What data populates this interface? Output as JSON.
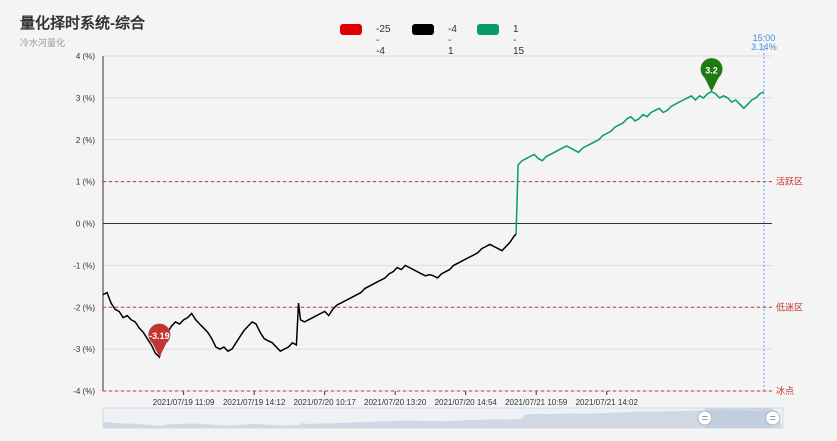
{
  "title": "量化择时系统-综合",
  "subtitle": "冷水河量化",
  "legend": [
    {
      "label": "-25 - -4",
      "color": "#e00000"
    },
    {
      "label": "-4 - 1",
      "color": "#000000"
    },
    {
      "label": "1 - 15",
      "color": "#079b6b"
    }
  ],
  "chart_data": {
    "type": "line",
    "title": "量化择时系统-综合",
    "ylabel": "",
    "ylim": [
      -4,
      4
    ],
    "y_ticks": [
      "-4 (%)",
      "-3 (%)",
      "-2 (%)",
      "-1 (%)",
      "0 (%)",
      "1 (%)",
      "2 (%)",
      "3 (%)",
      "4 (%)"
    ],
    "x_tick_labels": [
      "2021/07/19 11:09",
      "2021/07/19 14:12",
      "2021/07/20 10:17",
      "2021/07/20 13:20",
      "2021/07/20 14:54",
      "2021/07/21 10:59",
      "2021/07/21 14:02"
    ],
    "markers": [
      {
        "label": "-3.19",
        "value": -3.19,
        "color": "#c23531"
      },
      {
        "label": "3.2",
        "value": 3.2,
        "color": "#1e7a12"
      }
    ],
    "thresholds": [
      {
        "value": 1,
        "label": "活跃区"
      },
      {
        "value": -2,
        "label": "低迷区"
      },
      {
        "value": -4,
        "label": "冰点"
      }
    ],
    "crosshair": {
      "time": "15:00",
      "value": "3.14%"
    },
    "series": [
      {
        "points": [
          [
            0,
            -1.7
          ],
          [
            2,
            -1.65
          ],
          [
            4,
            -1.9
          ],
          [
            6,
            -2.05
          ],
          [
            8,
            -2.1
          ],
          [
            10,
            -2.25
          ],
          [
            12,
            -2.2
          ],
          [
            14,
            -2.3
          ],
          [
            16,
            -2.35
          ],
          [
            18,
            -2.5
          ],
          [
            20,
            -2.6
          ],
          [
            22,
            -2.75
          ],
          [
            24,
            -2.9
          ],
          [
            26,
            -3.1
          ],
          [
            28,
            -3.19
          ],
          [
            30,
            -2.75
          ],
          [
            32,
            -2.6
          ],
          [
            34,
            -2.45
          ],
          [
            36,
            -2.35
          ],
          [
            38,
            -2.4
          ],
          [
            40,
            -2.3
          ],
          [
            42,
            -2.25
          ],
          [
            44,
            -2.15
          ],
          [
            46,
            -2.3
          ],
          [
            48,
            -2.4
          ],
          [
            50,
            -2.5
          ],
          [
            52,
            -2.6
          ],
          [
            54,
            -2.75
          ],
          [
            56,
            -2.95
          ],
          [
            58,
            -3.0
          ],
          [
            60,
            -2.95
          ],
          [
            62,
            -3.05
          ],
          [
            64,
            -3.0
          ],
          [
            66,
            -2.85
          ],
          [
            68,
            -2.7
          ],
          [
            70,
            -2.55
          ],
          [
            72,
            -2.45
          ],
          [
            74,
            -2.35
          ],
          [
            76,
            -2.4
          ],
          [
            78,
            -2.6
          ],
          [
            80,
            -2.75
          ],
          [
            82,
            -2.8
          ],
          [
            84,
            -2.85
          ],
          [
            86,
            -2.95
          ],
          [
            88,
            -3.05
          ],
          [
            90,
            -3.0
          ],
          [
            92,
            -2.95
          ],
          [
            94,
            -2.85
          ],
          [
            96,
            -2.9
          ],
          [
            97,
            -1.9
          ],
          [
            98,
            -2.3
          ],
          [
            100,
            -2.35
          ],
          [
            102,
            -2.3
          ],
          [
            104,
            -2.25
          ],
          [
            106,
            -2.2
          ],
          [
            108,
            -2.15
          ],
          [
            110,
            -2.1
          ],
          [
            112,
            -2.2
          ],
          [
            114,
            -2.05
          ],
          [
            116,
            -1.95
          ],
          [
            118,
            -1.9
          ],
          [
            120,
            -1.85
          ],
          [
            122,
            -1.8
          ],
          [
            124,
            -1.75
          ],
          [
            126,
            -1.7
          ],
          [
            128,
            -1.65
          ],
          [
            130,
            -1.55
          ],
          [
            132,
            -1.5
          ],
          [
            134,
            -1.45
          ],
          [
            136,
            -1.4
          ],
          [
            138,
            -1.35
          ],
          [
            140,
            -1.3
          ],
          [
            142,
            -1.2
          ],
          [
            144,
            -1.15
          ],
          [
            146,
            -1.05
          ],
          [
            148,
            -1.1
          ],
          [
            150,
            -1.0
          ],
          [
            152,
            -1.05
          ],
          [
            154,
            -1.1
          ],
          [
            156,
            -1.15
          ],
          [
            158,
            -1.2
          ],
          [
            160,
            -1.25
          ],
          [
            162,
            -1.22
          ],
          [
            164,
            -1.25
          ],
          [
            166,
            -1.3
          ],
          [
            168,
            -1.2
          ],
          [
            170,
            -1.15
          ],
          [
            172,
            -1.1
          ],
          [
            174,
            -1.0
          ],
          [
            176,
            -0.95
          ],
          [
            178,
            -0.9
          ],
          [
            180,
            -0.85
          ],
          [
            182,
            -0.8
          ],
          [
            184,
            -0.75
          ],
          [
            186,
            -0.7
          ],
          [
            188,
            -0.6
          ],
          [
            190,
            -0.55
          ],
          [
            192,
            -0.5
          ],
          [
            194,
            -0.55
          ],
          [
            196,
            -0.6
          ],
          [
            198,
            -0.65
          ],
          [
            200,
            -0.55
          ],
          [
            202,
            -0.45
          ],
          [
            204,
            -0.3
          ],
          [
            205,
            -0.25
          ]
        ]
      },
      {
        "points": [
          [
            205,
            -0.25
          ],
          [
            206,
            1.4
          ],
          [
            208,
            1.5
          ],
          [
            210,
            1.55
          ],
          [
            212,
            1.6
          ],
          [
            214,
            1.65
          ],
          [
            216,
            1.55
          ],
          [
            218,
            1.5
          ],
          [
            220,
            1.6
          ],
          [
            222,
            1.65
          ],
          [
            224,
            1.7
          ],
          [
            226,
            1.75
          ],
          [
            228,
            1.8
          ],
          [
            230,
            1.85
          ],
          [
            232,
            1.8
          ],
          [
            234,
            1.75
          ],
          [
            236,
            1.7
          ],
          [
            238,
            1.8
          ],
          [
            240,
            1.85
          ],
          [
            242,
            1.9
          ],
          [
            244,
            1.95
          ],
          [
            246,
            2.0
          ],
          [
            248,
            2.1
          ],
          [
            250,
            2.15
          ],
          [
            252,
            2.2
          ],
          [
            254,
            2.3
          ],
          [
            256,
            2.35
          ],
          [
            258,
            2.4
          ],
          [
            260,
            2.5
          ],
          [
            262,
            2.55
          ],
          [
            264,
            2.45
          ],
          [
            266,
            2.5
          ],
          [
            268,
            2.6
          ],
          [
            270,
            2.55
          ],
          [
            272,
            2.65
          ],
          [
            274,
            2.7
          ],
          [
            276,
            2.75
          ],
          [
            278,
            2.65
          ],
          [
            280,
            2.7
          ],
          [
            282,
            2.8
          ],
          [
            284,
            2.85
          ],
          [
            286,
            2.9
          ],
          [
            288,
            2.95
          ],
          [
            290,
            3.0
          ],
          [
            292,
            3.05
          ],
          [
            294,
            2.95
          ],
          [
            296,
            3.05
          ],
          [
            298,
            3.0
          ],
          [
            300,
            3.1
          ],
          [
            302,
            3.15
          ],
          [
            304,
            3.1
          ],
          [
            306,
            3.0
          ],
          [
            308,
            3.05
          ],
          [
            310,
            3.0
          ],
          [
            312,
            2.9
          ],
          [
            314,
            2.95
          ],
          [
            316,
            2.85
          ],
          [
            318,
            2.75
          ],
          [
            320,
            2.85
          ],
          [
            322,
            2.95
          ],
          [
            324,
            3.0
          ],
          [
            326,
            3.1
          ],
          [
            328,
            3.14
          ]
        ]
      }
    ]
  }
}
